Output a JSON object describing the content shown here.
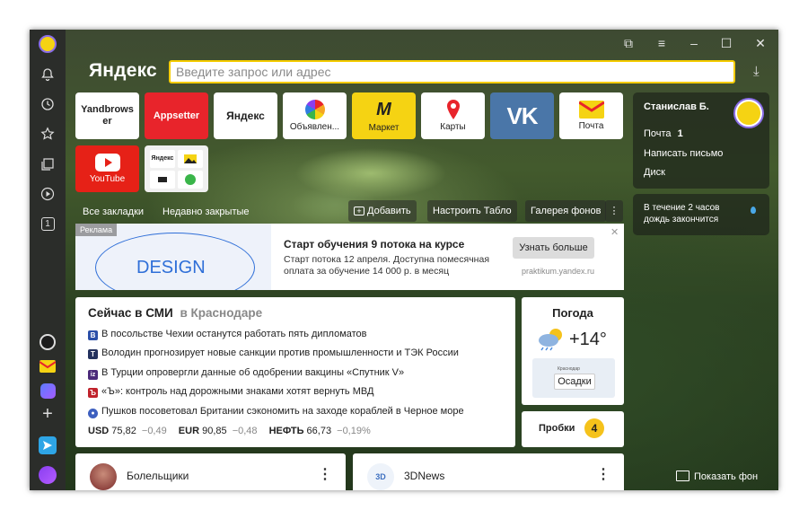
{
  "browser": {
    "logo": "Яндекс",
    "search_placeholder": "Введите запрос или адрес"
  },
  "tiles": [
    {
      "label": "Yandbrows er",
      "bg": "#ffffff",
      "kind": "text"
    },
    {
      "label": "Appsetter",
      "bg": "#e8242b",
      "kind": "text"
    },
    {
      "label": "Яндекс",
      "bg": "#ffffff",
      "kind": "text"
    },
    {
      "label": "Объявлен...",
      "bg": "#ffffff",
      "kind": "icon"
    },
    {
      "label": "Маркет",
      "bg": "#f5d313",
      "kind": "icon"
    },
    {
      "label": "Карты",
      "bg": "#ffffff",
      "kind": "icon"
    },
    {
      "label": "VK",
      "bg": "#4a76a8",
      "kind": "icon"
    },
    {
      "label": "Почта",
      "bg": "#ffffff",
      "kind": "icon"
    },
    {
      "label": "YouTube",
      "bg": "#e62117",
      "kind": "icon"
    }
  ],
  "folder_tile": {
    "items": [
      "Яндекс",
      "",
      "",
      ""
    ]
  },
  "bookmarks": {
    "all": "Все закладки",
    "recent": "Недавно закрытые",
    "add": "Добавить",
    "customize": "Настроить Табло",
    "gallery": "Галерея фонов"
  },
  "profile": {
    "name": "Станислав Б.",
    "mail_label": "Почта",
    "mail_count": "1",
    "write": "Написать письмо",
    "disk": "Диск"
  },
  "rain": {
    "text": "В течение 2 часов дождь закончится"
  },
  "ad": {
    "badge": "Реклама",
    "image_text": "DESIGN",
    "title": "Старт обучения 9 потока на курсе",
    "body": "Старт потока 12 апреля. Доступна помесячная оплата за обучение 14 000 р. в месяц",
    "button": "Узнать больше",
    "domain": "praktikum.yandex.ru"
  },
  "news": {
    "title": "Сейчас в СМИ",
    "region": "в Краснодаре",
    "items": [
      {
        "text": "В посольстве Чехии останутся работать пять дипломатов",
        "icon_color": "#2b4fa8",
        "icon_letter": "В"
      },
      {
        "text": "Володин прогнозирует новые санкции против промышленности и ТЭК России",
        "icon_color": "#23315e",
        "icon_letter": "T"
      },
      {
        "text": "В Турции опровергли данные об одобрении вакцины «Спутник V»",
        "icon_color": "#4b2a7a",
        "icon_letter": "iz"
      },
      {
        "text": "«Ъ»: контроль над дорожными знаками хотят вернуть МВД",
        "icon_color": "#c0222b",
        "icon_letter": "Ъ"
      },
      {
        "text": "Пушков посоветовал Британии сэкономить на заходе кораблей в Черное море",
        "icon_color": "#3d5fbf",
        "icon_letter": "●"
      }
    ],
    "rates": [
      {
        "code": "USD",
        "value": "75,82",
        "change": "−0,49"
      },
      {
        "code": "EUR",
        "value": "90,85",
        "change": "−0,48"
      },
      {
        "code": "НЕФТЬ",
        "value": "66,73",
        "change": "−0,19%"
      }
    ]
  },
  "weather": {
    "title": "Погода",
    "temp": "+14°",
    "city": "Осадки",
    "map_label": "Краснодар"
  },
  "traffic": {
    "label": "Пробки",
    "score": "4"
  },
  "cards": [
    {
      "title": "Болельщики"
    },
    {
      "title": "3DNews",
      "logo": "3D"
    }
  ],
  "show_bg": "Показать фон",
  "rail": {
    "badge": "1"
  }
}
